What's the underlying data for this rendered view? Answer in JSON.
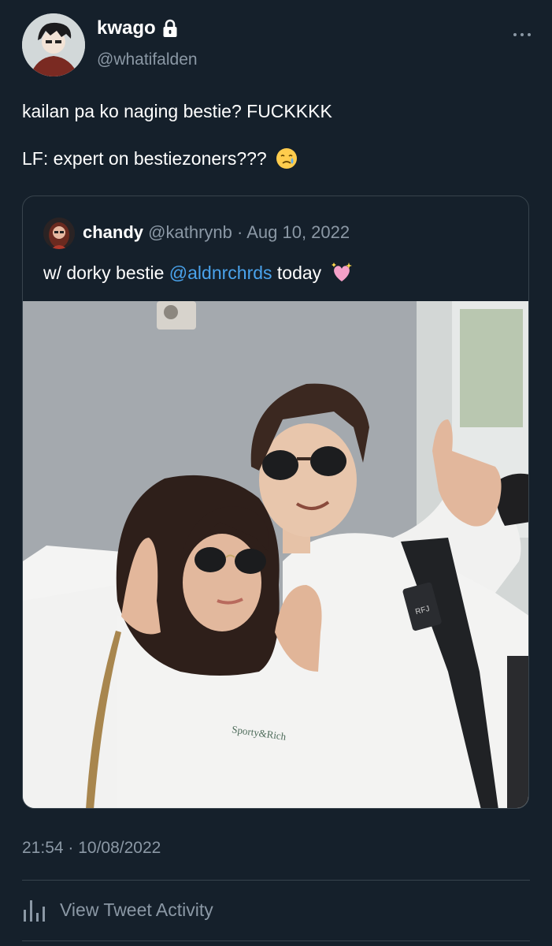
{
  "author": {
    "display_name": "kwago",
    "handle": "@whatifalden",
    "avatar_icon": "avatar-anime-boy",
    "lock_icon": "lock-icon"
  },
  "tweet": {
    "line1": "kailan pa ko naging bestie? FUCKKKK",
    "line2": "LF: expert on bestiezoners???",
    "line2_emoji": "crying-face-emoji"
  },
  "quoted_tweet": {
    "display_name": "chandy",
    "handle": "@kathrynb",
    "separator": "·",
    "date": "Aug 10, 2022",
    "text_before": "w/ dorky bestie ",
    "mention": "@aldnrchrds",
    "text_after": " today",
    "emoji": "sparkling-heart-emoji",
    "photo_shirt_text": "Sporty&Rich",
    "photo_tag_text": "RFJ"
  },
  "timestamp": "21:54 · 10/08/2022",
  "activity_label": "View Tweet Activity",
  "colors": {
    "background": "#15202b",
    "secondary_text": "#8b98a5",
    "link": "#4aa3ec",
    "border": "#38444d"
  }
}
